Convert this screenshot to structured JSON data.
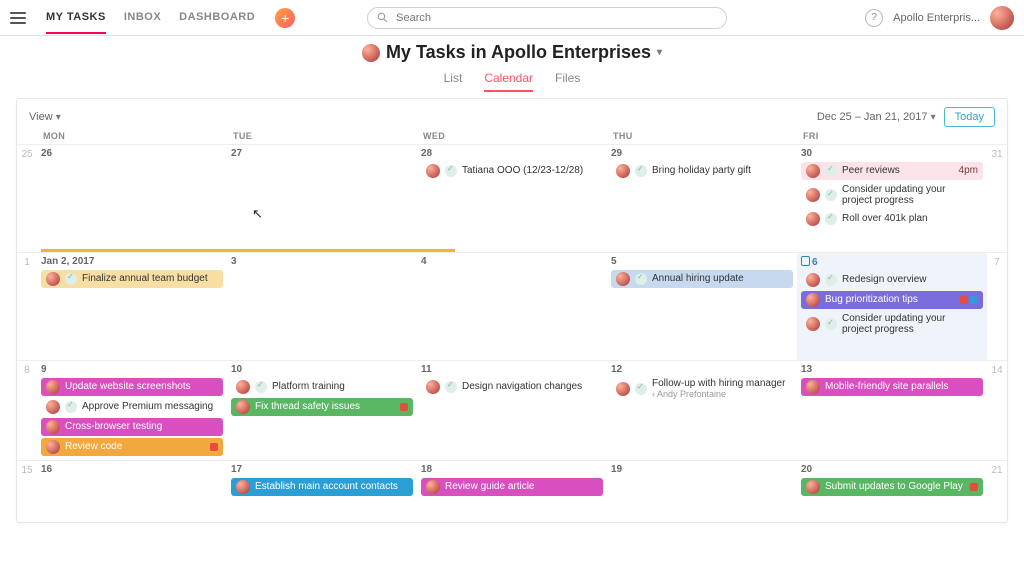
{
  "nav": {
    "tabs": [
      "MY TASKS",
      "INBOX",
      "DASHBOARD"
    ],
    "active": 0
  },
  "search": {
    "placeholder": "Search"
  },
  "org": "Apollo Enterpris...",
  "title": "My Tasks in Apollo Enterprises",
  "view_tabs": {
    "items": [
      "List",
      "Calendar",
      "Files"
    ],
    "active": 1
  },
  "toolbar": {
    "view_label": "View",
    "range": "Dec 25 – Jan 21, 2017",
    "today": "Today"
  },
  "dow": [
    "MON",
    "TUE",
    "WED",
    "THU",
    "FRI"
  ],
  "weeks": [
    {
      "left": "25",
      "right": "31",
      "days": [
        {
          "date": "26",
          "events": []
        },
        {
          "date": "27",
          "events": []
        },
        {
          "date": "28",
          "events": [
            {
              "t": "Tatiana OOO (12/23-12/28)",
              "style": "plain"
            }
          ]
        },
        {
          "date": "29",
          "events": [
            {
              "t": "Bring holiday party gift",
              "style": "plain"
            }
          ]
        },
        {
          "date": "30",
          "events": [
            {
              "t": "Peer reviews",
              "style": "pinkL",
              "time": "4pm"
            },
            {
              "t": "Consider updating your project progress",
              "style": "plain",
              "wrap": true
            },
            {
              "t": "Roll over 401k plan",
              "style": "plain"
            }
          ]
        }
      ]
    },
    {
      "left": "1",
      "right": "7",
      "days": [
        {
          "date": "Jan 2, 2017",
          "events": [
            {
              "t": "Finalize annual team budget",
              "style": "amber"
            }
          ]
        },
        {
          "date": "3",
          "events": []
        },
        {
          "date": "4",
          "events": []
        },
        {
          "date": "5",
          "events": [
            {
              "t": "Annual hiring update",
              "style": "blueL"
            }
          ]
        },
        {
          "date": "6",
          "today": true,
          "events": [
            {
              "t": "Redesign overview",
              "style": "plain"
            },
            {
              "t": "Bug prioritization tips",
              "style": "purple",
              "tags": [
                "red",
                "blue"
              ]
            },
            {
              "t": "Consider updating your project progress",
              "style": "plain",
              "wrap": true
            }
          ]
        }
      ]
    },
    {
      "left": "8",
      "right": "14",
      "days": [
        {
          "date": "9",
          "events": [
            {
              "t": "Update website screenshots",
              "style": "mag"
            },
            {
              "t": "Approve Premium messaging",
              "style": "plain"
            },
            {
              "t": "Cross-browser testing",
              "style": "mag"
            },
            {
              "t": "Review code",
              "style": "orange",
              "tags": [
                "red"
              ]
            }
          ]
        },
        {
          "date": "10",
          "events": [
            {
              "t": "Platform training",
              "style": "plain"
            },
            {
              "t": "Fix thread safety issues",
              "style": "green",
              "tags": [
                "red"
              ]
            }
          ]
        },
        {
          "date": "11",
          "events": [
            {
              "t": "Design navigation changes",
              "style": "plain"
            }
          ]
        },
        {
          "date": "12",
          "events": [
            {
              "t": "Follow-up with hiring manager",
              "sub": "Andy Prefontaine",
              "style": "plain"
            }
          ]
        },
        {
          "date": "13",
          "events": [
            {
              "t": "Mobile-friendly site parallels",
              "style": "mag"
            }
          ]
        }
      ]
    },
    {
      "left": "15",
      "right": "21",
      "short": true,
      "days": [
        {
          "date": "16",
          "events": []
        },
        {
          "date": "17",
          "events": [
            {
              "t": "Establish main account contacts",
              "style": "blue"
            }
          ]
        },
        {
          "date": "18",
          "events": [
            {
              "t": "Review guide article",
              "style": "mag"
            }
          ]
        },
        {
          "date": "19",
          "events": []
        },
        {
          "date": "20",
          "events": [
            {
              "t": "Submit updates to Google Play",
              "style": "green",
              "tags": [
                "red"
              ]
            }
          ]
        }
      ]
    }
  ]
}
